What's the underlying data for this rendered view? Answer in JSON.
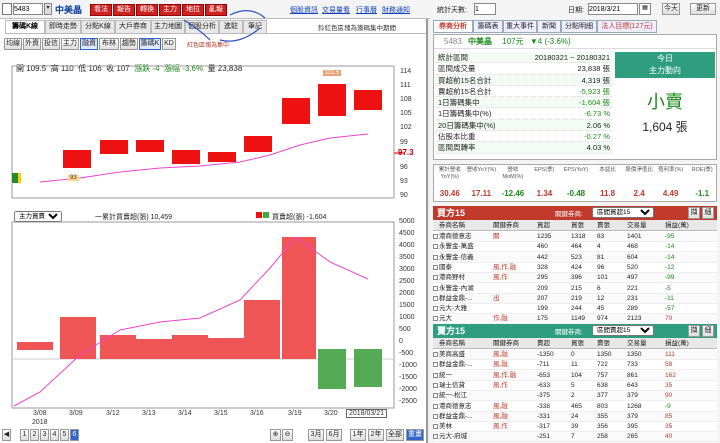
{
  "stock": {
    "code": "5483",
    "name": "中美晶"
  },
  "toolbar": {
    "buttons": [
      "看法",
      "報告",
      "轉換",
      "主力",
      "地拉",
      "亂報"
    ],
    "links": [
      "個股資訊",
      "交易量看",
      "行事曆",
      "財務通知"
    ]
  },
  "left_tabs": [
    "籌碼K線",
    "即時走勢",
    "分點K線",
    "大戶券商",
    "主力地圖",
    "個股分析",
    "進駐",
    "筆記"
  ],
  "sub_buttons": [
    "均線",
    "外資",
    "投信",
    "主力",
    "融資",
    "布林",
    "趨勢",
    "籌碼K",
    "KD"
  ],
  "ohlc": {
    "open": "開 109.5",
    "high": "高 110",
    "low": "低 106",
    "close": "收 107",
    "chg": "漲跌 -4",
    "pct": "漲幅 -3.6%",
    "vol": "量 23,838"
  },
  "note_red": "紅色區塊為集中",
  "note_top": "鈴紅色區塊為籌碼集中期間",
  "marker_top": "111.5",
  "marker_low": "93",
  "price_now": "97.3",
  "price_axis": [
    "114",
    "111",
    "108",
    "105",
    "102",
    "99",
    "96",
    "93",
    "90"
  ],
  "dates": [
    "3/08",
    "3/09",
    "3/12",
    "3/13",
    "3/14",
    "3/15",
    "3/16",
    "3/19",
    "3/20",
    "2018/03/21"
  ],
  "year": "2018",
  "lower": {
    "select": "主力買賣超",
    "legend1": "一累計買賣超(張) 10,459",
    "legend2": "買賣超(張) -1,604",
    "axis": [
      "5000",
      "4500",
      "4000",
      "3500",
      "3000",
      "2500",
      "2000",
      "1500",
      "1000",
      "500",
      "0",
      "-500",
      "-1000",
      "-1500",
      "-2000",
      "-2500"
    ]
  },
  "bottom": {
    "zoom": [
      "1",
      "2",
      "3",
      "4",
      "5",
      "6"
    ],
    "periods": [
      "3月",
      "6月",
      "1年",
      "2年",
      "全部",
      "重畫"
    ]
  },
  "right_top": {
    "label_range": "統計天數:",
    "range": "1",
    "label_date": "日期:",
    "date": "2018/3/21",
    "today": "今天",
    "refresh": "更新"
  },
  "right_tabs": [
    "券商分析",
    "籌碼表",
    "重大事件",
    "新聞",
    "分點明細",
    "法人目標(127元)"
  ],
  "quote": {
    "code": "5483",
    "name": "中美晶",
    "price": "107元",
    "chg": "▼4 (-3.6%)"
  },
  "stats": [
    {
      "k": "統計區間",
      "v": "20180321 ~ 20180321"
    },
    {
      "k": "區間成交量",
      "v": "23,838 張"
    },
    {
      "k": "買超前15名合計",
      "v": "4,319 張"
    },
    {
      "k": "賣超前15名合計",
      "v": "-5,923 張"
    },
    {
      "k": "1日籌碼集中",
      "v": "-1,604 張"
    },
    {
      "k": "1日籌碼集中(%)",
      "v": "-6.73 %"
    },
    {
      "k": "20日籌碼集中(%)",
      "v": "2.06 %"
    },
    {
      "k": "佔股本比重",
      "v": "-0.27 %"
    },
    {
      "k": "區間周轉率",
      "v": "4.03 %"
    }
  ],
  "today_box": {
    "title": "今日",
    "sub": "主力動向",
    "action": "小賣",
    "amount": "1,604 張"
  },
  "fund": {
    "headers": [
      "累計營收YoY(%)",
      "營收YoY(%)",
      "營收MoM(%)",
      "EPS(季)",
      "EPS(YoY)",
      "本益比",
      "股價淨值比",
      "殖利率(%)",
      "ROE(季)"
    ],
    "values": [
      "30.46",
      "17.11",
      "-12.46",
      "1.34",
      "-0.48",
      "11.8",
      "2.4",
      "4.49",
      "-1.1"
    ]
  },
  "buy": {
    "title": "買方15",
    "sel_label": "關鍵券商:",
    "sel": "區間買超15",
    "btn1": "擷",
    "btn2": "細",
    "cols": [
      "券商名稱",
      "關鍵券商",
      "買超",
      "買張",
      "賣張",
      "交易量",
      "損益(萬)"
    ],
    "rows": [
      [
        "港商德意志",
        "關",
        "1235",
        "1318",
        "83",
        "1401",
        "-95"
      ],
      [
        "永豐金-萬盛",
        "",
        "460",
        "464",
        "4",
        "468",
        "-14"
      ],
      [
        "永豐金-信義",
        "",
        "442",
        "523",
        "81",
        "604",
        "-14"
      ],
      [
        "國泰",
        "風,作,融",
        "328",
        "424",
        "96",
        "520",
        "-12"
      ],
      [
        "港商野村",
        "風,作",
        "295",
        "396",
        "101",
        "497",
        "-99"
      ],
      [
        "永豐金-內湖",
        "",
        "209",
        "215",
        "6",
        "221",
        "-5"
      ],
      [
        "群益金鼎-...",
        "出",
        "207",
        "219",
        "12",
        "231",
        "-11"
      ],
      [
        "元大-大雅",
        "",
        "199",
        "244",
        "45",
        "289",
        "-57"
      ],
      [
        "元大",
        "作,融",
        "175",
        "1149",
        "974",
        "2123",
        "70"
      ]
    ]
  },
  "sell": {
    "title": "賣方15",
    "sel_label": "關鍵券商:",
    "sel": "區間賣超15",
    "btn1": "擷",
    "btn2": "細",
    "cols": [
      "券商名稱",
      "關鍵券商",
      "賣超",
      "買張",
      "賣張",
      "交易量",
      "損益(萬)"
    ],
    "rows": [
      [
        "美商高盛",
        "風,融",
        "-1350",
        "0",
        "1350",
        "1350",
        "111"
      ],
      [
        "群益金鼎-...",
        "風,融",
        "-711",
        "11",
        "722",
        "733",
        "58"
      ],
      [
        "統一",
        "風,作,融",
        "-653",
        "104",
        "757",
        "861",
        "162"
      ],
      [
        "瑞士信貸",
        "風,作",
        "-633",
        "5",
        "638",
        "643",
        "35"
      ],
      [
        "統一-松江",
        "",
        "-375",
        "2",
        "377",
        "379",
        "90"
      ],
      [
        "港商德意志",
        "風,融",
        "-338",
        "465",
        "803",
        "1268",
        "-9"
      ],
      [
        "群益金鼎-...",
        "風,融",
        "-331",
        "24",
        "355",
        "379",
        "85"
      ],
      [
        "美林",
        "風,作",
        "-317",
        "39",
        "356",
        "395",
        "35"
      ],
      [
        "元大-府城",
        "",
        "-251",
        "7",
        "258",
        "265",
        "40"
      ]
    ]
  },
  "colors": {
    "up": "#ee1111",
    "down": "#44aa44",
    "accent": "#c0392b",
    "line": "#ee44cc"
  }
}
